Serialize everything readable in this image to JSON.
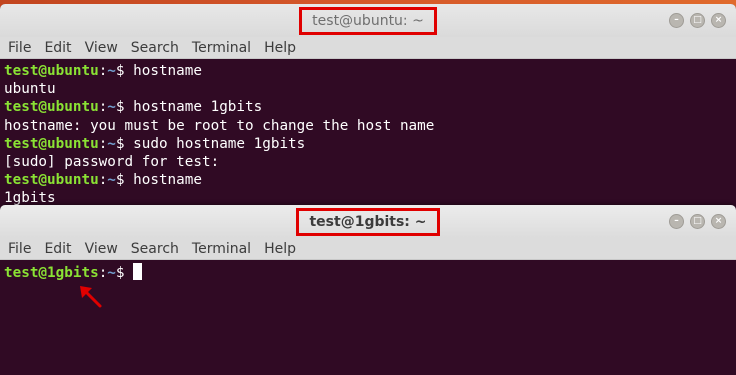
{
  "windows": [
    {
      "title": "test@ubuntu: ~",
      "menu": [
        "File",
        "Edit",
        "View",
        "Search",
        "Terminal",
        "Help"
      ],
      "lines": [
        {
          "type": "prompt",
          "user": "test@ubuntu",
          "sep": ":",
          "dir": "~",
          "sym": "$ ",
          "cmd": "hostname"
        },
        {
          "type": "output",
          "text": "ubuntu"
        },
        {
          "type": "prompt",
          "user": "test@ubuntu",
          "sep": ":",
          "dir": "~",
          "sym": "$ ",
          "cmd": "hostname 1gbits"
        },
        {
          "type": "output",
          "text": "hostname: you must be root to change the host name"
        },
        {
          "type": "prompt",
          "user": "test@ubuntu",
          "sep": ":",
          "dir": "~",
          "sym": "$ ",
          "cmd": "sudo hostname 1gbits"
        },
        {
          "type": "output",
          "text": "[sudo] password for test:"
        },
        {
          "type": "prompt",
          "user": "test@ubuntu",
          "sep": ":",
          "dir": "~",
          "sym": "$ ",
          "cmd": "hostname"
        },
        {
          "type": "output",
          "text": "1gbits"
        }
      ]
    },
    {
      "title": "test@1gbits: ~",
      "menu": [
        "File",
        "Edit",
        "View",
        "Search",
        "Terminal",
        "Help"
      ],
      "lines": [
        {
          "type": "prompt",
          "user": "test@1gbits",
          "sep": ":",
          "dir": "~",
          "sym": "$ ",
          "cmd": "",
          "cursor": true
        }
      ]
    }
  ],
  "window_controls": {
    "minimize": "–",
    "maximize": "□",
    "close": "×"
  },
  "colors": {
    "terminal_bg": "#300a24",
    "prompt_user": "#8ae234",
    "prompt_dir": "#729fcf",
    "highlight": "#e00000",
    "desktop": "#d4572a"
  },
  "icons": {
    "annotation": "red-arrow-icon"
  }
}
